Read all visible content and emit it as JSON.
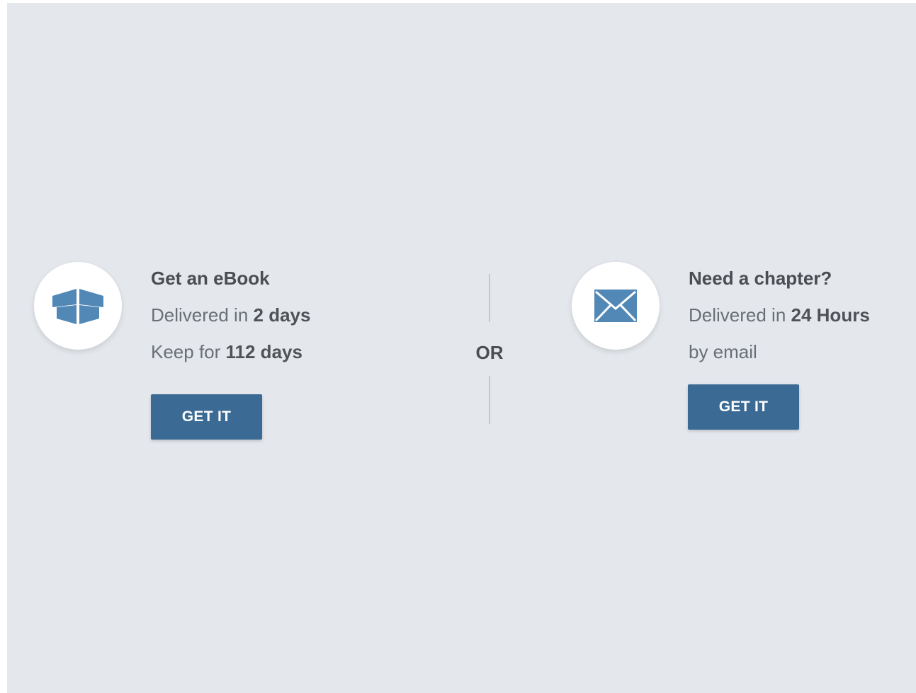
{
  "ebook_offer": {
    "icon": "open-box-icon",
    "title": "Get an eBook",
    "delivery_prefix": "Delivered in ",
    "delivery_value": "2 days",
    "keep_prefix": "Keep for ",
    "keep_value": "112 days",
    "button_label": "GET IT"
  },
  "divider": {
    "label": "OR"
  },
  "chapter_offer": {
    "icon": "envelope-icon",
    "title": "Need a chapter?",
    "delivery_prefix": "Delivered in ",
    "delivery_value": "24 Hours",
    "method": "by email",
    "button_label": "GET IT"
  },
  "colors": {
    "background": "#e4e8ed",
    "accent": "#3b6a94",
    "icon": "#5288b6"
  }
}
